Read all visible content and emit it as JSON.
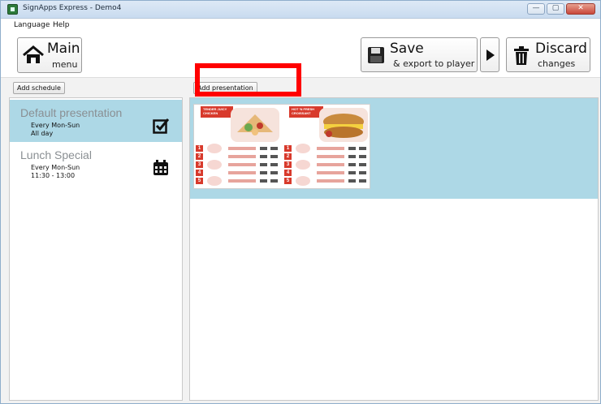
{
  "window": {
    "title": "SignApps Express - Demo4",
    "controls": {
      "minimize": "—",
      "maximize": "▢",
      "close": "✕"
    }
  },
  "menu": {
    "language": "Language",
    "help": "Help"
  },
  "toolbar": {
    "main": {
      "title": "Main",
      "subtitle": "menu",
      "icon": "home-icon"
    },
    "save": {
      "title": "Save",
      "subtitle": "& export to player",
      "icon": "floppy-disk-icon"
    },
    "play": {
      "icon": "play-icon"
    },
    "discard": {
      "title": "Discard",
      "subtitle": "changes",
      "icon": "trash-icon"
    }
  },
  "schedules": {
    "add_label": "Add schedule",
    "items": [
      {
        "name": "Default presentation",
        "line1": "Every Mon-Sun",
        "line2": "All day",
        "icon": "checkbox-icon",
        "selected": true
      },
      {
        "name": "Lunch Special",
        "line1": "Every Mon-Sun",
        "line2": "11:30 - 13:00",
        "icon": "calendar-icon",
        "selected": false
      }
    ]
  },
  "presentations": {
    "add_label": "Add presentation",
    "thumbnail": {
      "left_heading": "TENDER JUICY CHICKEN",
      "right_heading": "HOT 'N FRESH CROISSANT",
      "numbers": [
        "1",
        "2",
        "3",
        "4",
        "5"
      ]
    }
  },
  "colors": {
    "selection": "#add8e6",
    "highlight": "#ff0000",
    "menu_red": "#d83a2c"
  }
}
